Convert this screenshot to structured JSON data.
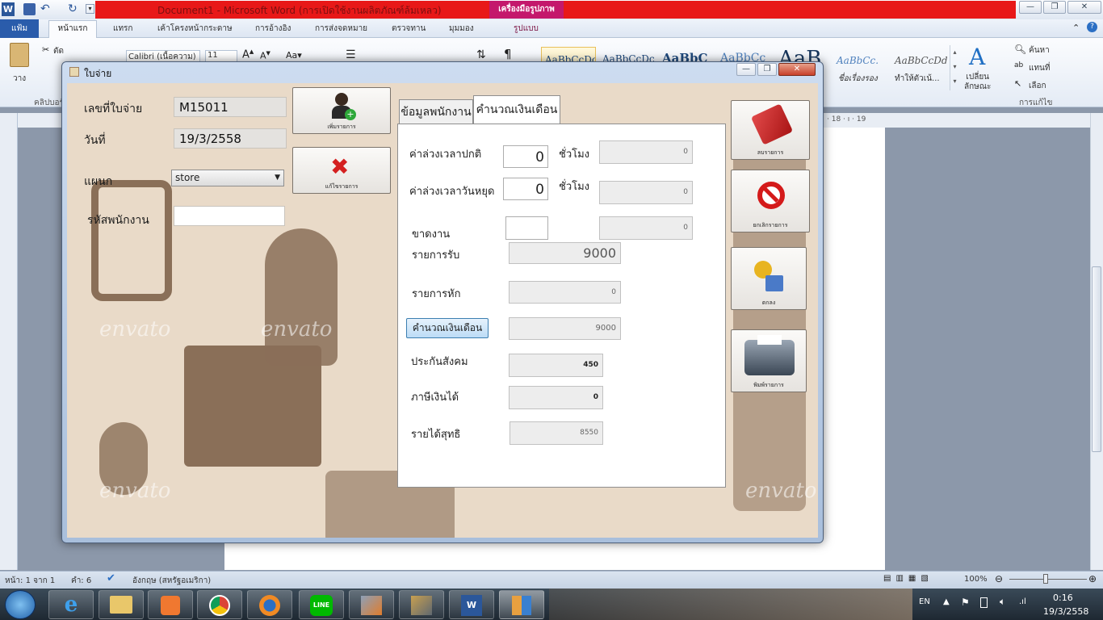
{
  "word": {
    "title": "Document1 - Microsoft Word (การเปิดใช้งานผลิตภัณฑ์ล้มเหลว)",
    "contextual_tab_group": "เครื่องมือรูปภาพ",
    "tabs": [
      "แฟ้ม",
      "หน้าแรก",
      "แทรก",
      "เค้าโครงหน้ากระดาษ",
      "การอ้างอิง",
      "การส่งจดหมาย",
      "ตรวจทาน",
      "มุมมอง",
      "รูปแบบ"
    ],
    "clipboard": {
      "paste": "วาง",
      "cut": "ตัด",
      "group": "คลิปบอร์ด"
    },
    "font_name": "Calibri (เนื้อความ)",
    "font_size": "11",
    "styles": [
      {
        "sample": "AaBbCcDc",
        "name": ""
      },
      {
        "sample": "AaBbCcDc",
        "name": ""
      },
      {
        "sample": "AaBbC",
        "name": ""
      },
      {
        "sample": "AaBbCc",
        "name": ""
      },
      {
        "sample": "AaB",
        "name": ""
      },
      {
        "sample": "AaBbCc.",
        "name": "ชื่อเรื่องรอง"
      },
      {
        "sample": "AaBbCcDd",
        "name": "ทำให้ตัวเน้..."
      }
    ],
    "change_styles": "เปลี่ยน\nลักษณะ",
    "editing": {
      "find": "ค้นหา",
      "replace": "แทนที่",
      "select": "เลือก",
      "group": "การแก้ไข"
    },
    "ruler_text": "· 18 · ı · 19",
    "status": {
      "page": "หน้า: 1 จาก 1",
      "words": "คำ: 6",
      "language": "อังกฤษ (สหรัฐอเมริกา)",
      "zoom": "100%"
    }
  },
  "taskbar": {
    "lang": "EN",
    "time": "0:16",
    "date": "19/3/2558",
    "apps": [
      "ie",
      "explorer",
      "media",
      "chrome",
      "firefox",
      "line",
      "app7",
      "app8",
      "word",
      "app10"
    ]
  },
  "dialog": {
    "title": "ใบจ่าย",
    "fields": {
      "slip_no_label": "เลขที่ใบจ่าย",
      "slip_no": "M15011",
      "date_label": "วันที่",
      "date": "19/3/2558",
      "dept_label": "แผนก",
      "dept": "store",
      "emp_label": "รหัสพนักงาน",
      "emp": ""
    },
    "buttons": {
      "add": "เพิ่มรายการ",
      "edit": "แก้ไขรายการ",
      "delete": "ลบรายการ",
      "cancel": "ยกเลิกรายการ",
      "ok": "ตกลง",
      "print": "พิมพ์รายการ"
    },
    "tabs": {
      "employee": "ข้อมูลพนักงาน",
      "salary": "คำนวณเงินเดือน"
    },
    "salary": {
      "ot_normal_label": "ค่าล่วงเวลาปกติ",
      "ot_normal_hours": "0",
      "hours_unit": "ชั่วโมง",
      "ot_normal_amount": "0",
      "ot_holiday_label": "ค่าล่วงเวลาวันหยุด",
      "ot_holiday_hours": "0",
      "ot_holiday_amount": "0",
      "absent_label": "ขาดงาน",
      "absent_days": "",
      "absent_amount": "0",
      "income_label": "รายการรับ",
      "income": "9000",
      "deduct_label": "รายการหัก",
      "deduct": "0",
      "calc_button": "คำนวณเงินเดือน",
      "calc_result": "9000",
      "ss_label": "ประกันสังคม",
      "ss": "450",
      "tax_label": "ภาษีเงินได้",
      "tax": "0",
      "net_label": "รายได้สุทธิ",
      "net": "8550"
    },
    "watermark": "envato"
  }
}
